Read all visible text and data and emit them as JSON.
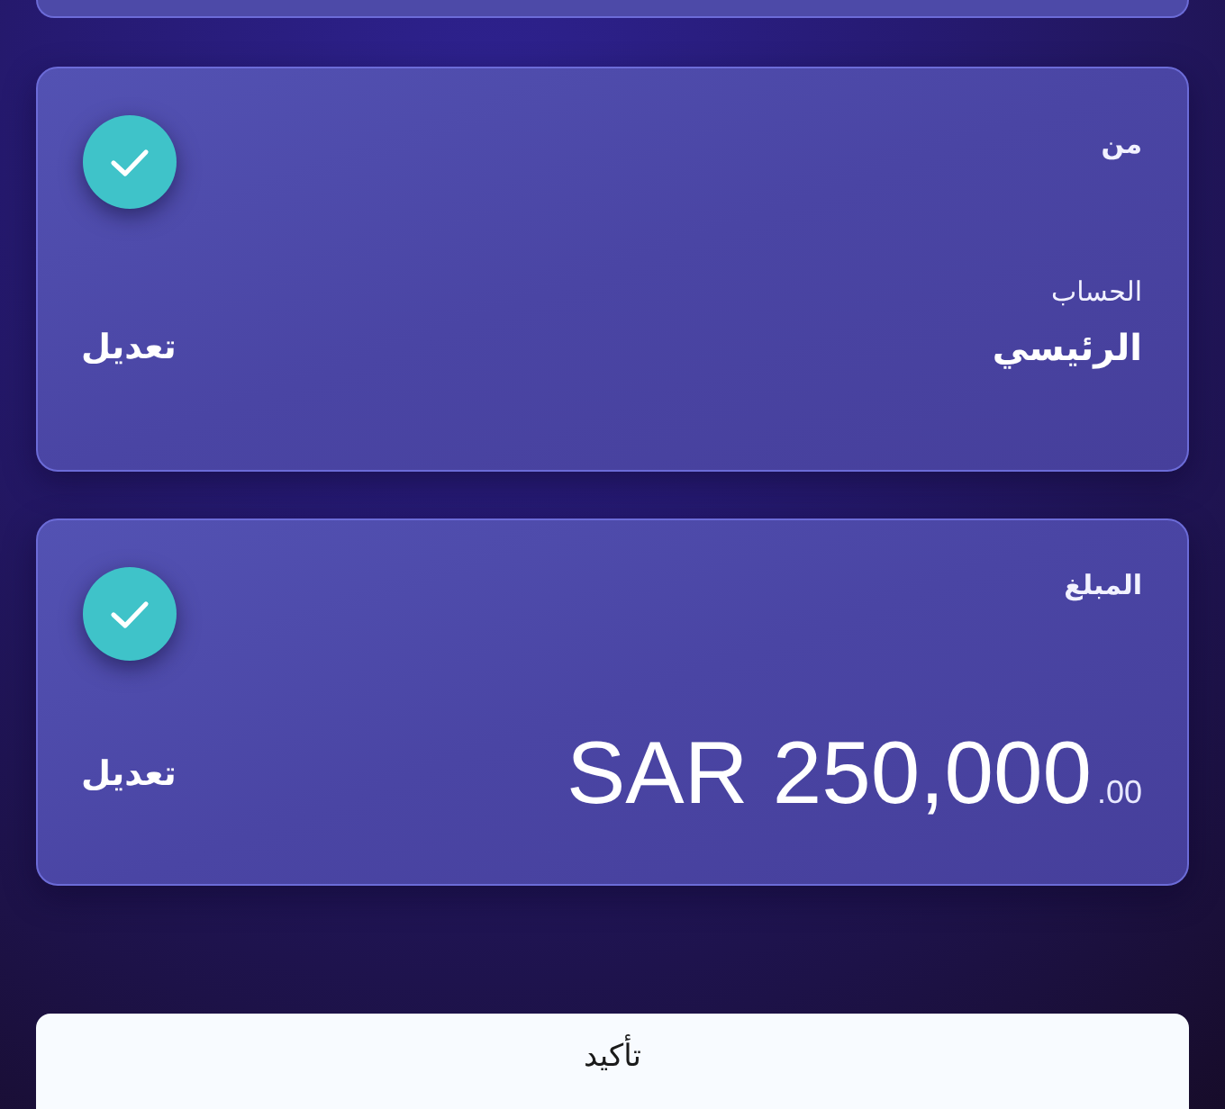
{
  "cards": [
    {
      "kind": "account",
      "label": "من",
      "verified": true,
      "field_label": "الحساب",
      "value": "الرئيسي",
      "action": "تعديل"
    },
    {
      "kind": "amount",
      "label": "المبلغ",
      "verified": true,
      "amount": {
        "main": "SAR 250,000",
        "fraction": ".00"
      },
      "action": "تعديل"
    }
  ],
  "confirm_button": {
    "label": "تأكيد"
  }
}
